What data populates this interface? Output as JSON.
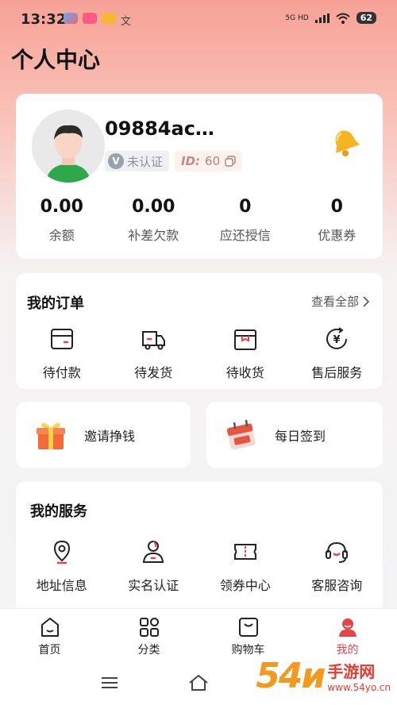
{
  "status_bar": {
    "time": "13:32",
    "network": "5G HD",
    "battery": "62"
  },
  "page": {
    "title": "个人中心"
  },
  "profile": {
    "username": "09884ac…",
    "verify_badge": "未认证",
    "id_label": "ID:",
    "id_value": "60",
    "stats": [
      {
        "value": "0.00",
        "label": "余额"
      },
      {
        "value": "0.00",
        "label": "补差欠款"
      },
      {
        "value": "0",
        "label": "应还授信"
      },
      {
        "value": "0",
        "label": "优惠券"
      }
    ]
  },
  "orders": {
    "title": "我的订单",
    "view_all": "查看全部",
    "items": [
      {
        "label": "待付款",
        "icon": "wallet-icon"
      },
      {
        "label": "待发货",
        "icon": "truck-icon"
      },
      {
        "label": "待收货",
        "icon": "box-icon"
      },
      {
        "label": "售后服务",
        "icon": "refund-icon"
      }
    ]
  },
  "promos": {
    "invite": {
      "label": "邀请挣钱",
      "icon": "gift-icon"
    },
    "checkin": {
      "label": "每日签到",
      "icon": "calendar-icon"
    }
  },
  "services": {
    "title": "我的服务",
    "items": [
      {
        "label": "地址信息",
        "icon": "location-icon"
      },
      {
        "label": "实名认证",
        "icon": "user-verify-icon"
      },
      {
        "label": "领券中心",
        "icon": "ticket-icon"
      },
      {
        "label": "客服咨询",
        "icon": "headset-icon"
      }
    ]
  },
  "tabbar": {
    "items": [
      {
        "label": "首页",
        "icon": "home-icon",
        "active": false
      },
      {
        "label": "分类",
        "icon": "category-icon",
        "active": false
      },
      {
        "label": "购物车",
        "icon": "cart-icon",
        "active": false
      },
      {
        "label": "我的",
        "icon": "profile-icon",
        "active": true
      }
    ]
  },
  "watermark": {
    "big": "54и",
    "cn": "手游网",
    "url": "www.54yo.cn"
  },
  "colors": {
    "accent": "#e8424a",
    "header_gradient_top": "#f7a196",
    "watermark_orange": "#f29a1f",
    "watermark_red": "#e63c2f"
  }
}
